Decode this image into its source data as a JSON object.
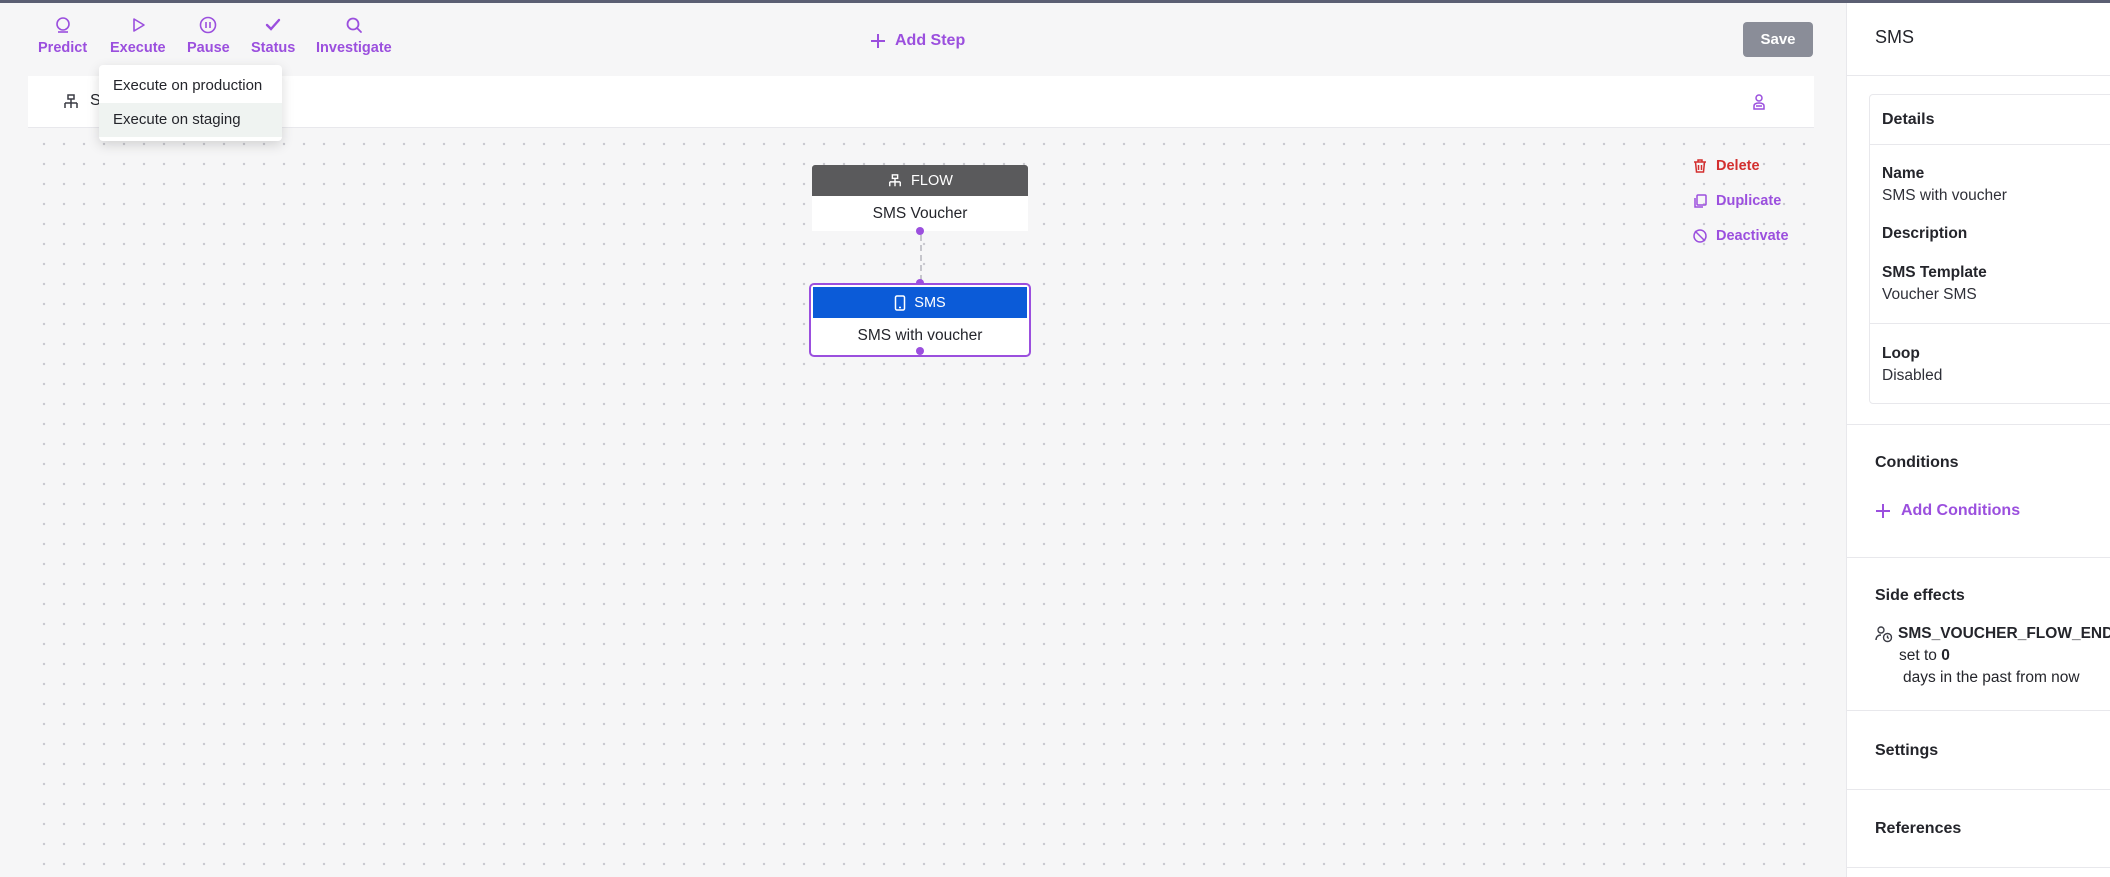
{
  "toolbar": {
    "predict": "Predict",
    "execute": "Execute",
    "pause": "Pause",
    "status": "Status",
    "investigate": "Investigate",
    "add_step": "Add Step",
    "save": "Save"
  },
  "execute_menu": {
    "items": [
      "Execute on production",
      "Execute on staging"
    ]
  },
  "canvas_header": {
    "flow_initial": "S"
  },
  "nodes": {
    "flow": {
      "type": "FLOW",
      "label": "SMS Voucher"
    },
    "sms": {
      "type": "SMS",
      "label": "SMS with voucher"
    }
  },
  "node_actions": {
    "delete": "Delete",
    "duplicate": "Duplicate",
    "deactivate": "Deactivate"
  },
  "panel": {
    "title": "SMS",
    "details": {
      "heading": "Details",
      "name_label": "Name",
      "name_value": "SMS with voucher",
      "description_label": "Description",
      "template_label": "SMS Template",
      "template_value": "Voucher SMS",
      "loop_label": "Loop",
      "loop_value": "Disabled"
    },
    "conditions": {
      "heading": "Conditions",
      "add_label": "Add Conditions"
    },
    "side_effects": {
      "heading": "Side effects",
      "name": "SMS_VOUCHER_FLOW_END",
      "set_prefix": "set to",
      "set_value": "0",
      "suffix": "days in the past from now"
    },
    "settings": "Settings",
    "references": "References"
  },
  "colors": {
    "accent": "#9b4fde",
    "sms_header": "#0b5bd8",
    "flow_header": "#5a5a5c",
    "delete": "#d32f2f",
    "save_bg": "#8a8d98"
  }
}
